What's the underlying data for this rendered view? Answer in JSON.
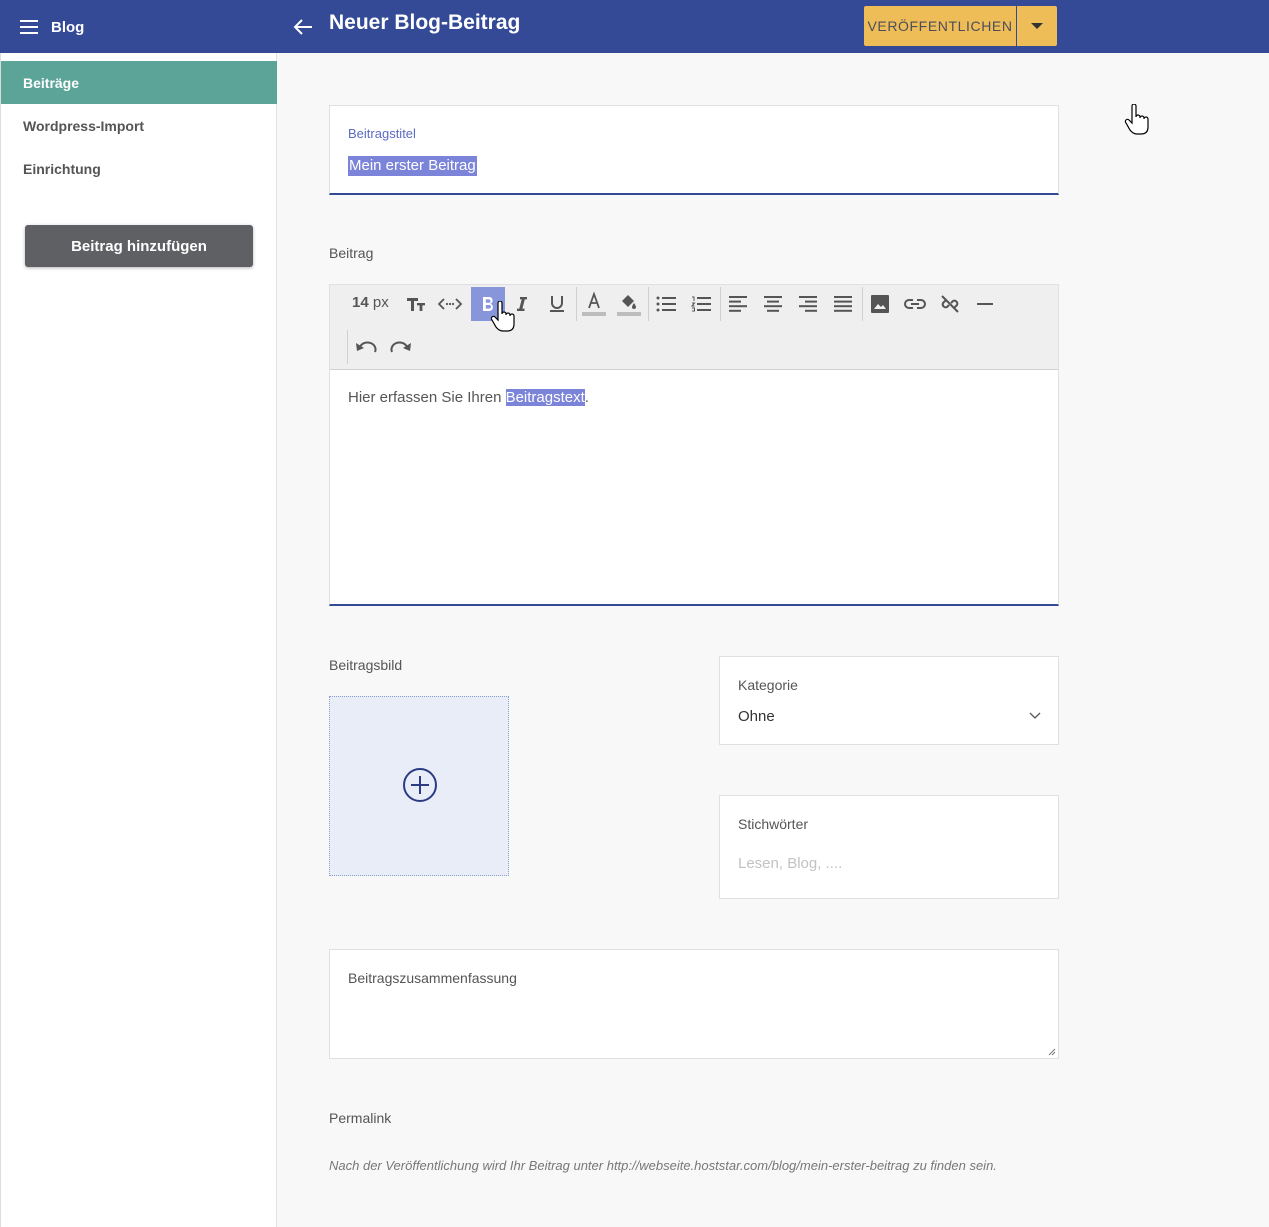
{
  "header": {
    "app_title": "Blog",
    "page_title": "Neuer Blog-Beitrag",
    "publish_label": "VERÖFFENTLICHEN",
    "colors": {
      "bar": "#354a96",
      "publish": "#efbd58"
    }
  },
  "sidebar": {
    "items": [
      {
        "label": "Beiträge",
        "active": true
      },
      {
        "label": "Wordpress-Import",
        "active": false
      },
      {
        "label": "Einrichtung",
        "active": false
      }
    ],
    "add_button": "Beitrag hinzufügen",
    "colors": {
      "active": "#5ca497",
      "button": "#5f6063"
    }
  },
  "post_title": {
    "label": "Beitragstitel",
    "value": "Mein erster Beitrag"
  },
  "body": {
    "label": "Beitrag",
    "font_size_value": "14",
    "font_size_unit": "px",
    "text_before": "Hier erfassen Sie Ihren ",
    "text_highlight": "Beitragstext",
    "text_after": ".",
    "toolbar_icons": [
      "text-size-icon",
      "code-view-icon",
      "bold-icon",
      "italic-icon",
      "underline-icon",
      "font-color-icon",
      "highlight-color-icon",
      "bullet-list-icon",
      "numbered-list-icon",
      "align-left-icon",
      "align-center-icon",
      "align-right-icon",
      "align-justify-icon",
      "image-icon",
      "link-icon",
      "unlink-icon",
      "horizontal-rule-icon",
      "undo-icon",
      "redo-icon"
    ]
  },
  "featured_image": {
    "label": "Beitragsbild",
    "icon": "add-circle-icon"
  },
  "category": {
    "label": "Kategorie",
    "value": "Ohne"
  },
  "tags": {
    "label": "Stichwörter",
    "placeholder": "Lesen, Blog, ...."
  },
  "summary": {
    "label": "Beitragszusammenfassung"
  },
  "permalink": {
    "label": "Permalink",
    "text": "Nach der Veröffentlichung wird Ihr Beitrag unter http://webseite.hoststar.com/blog/mein-erster-beitrag zu finden sein."
  }
}
